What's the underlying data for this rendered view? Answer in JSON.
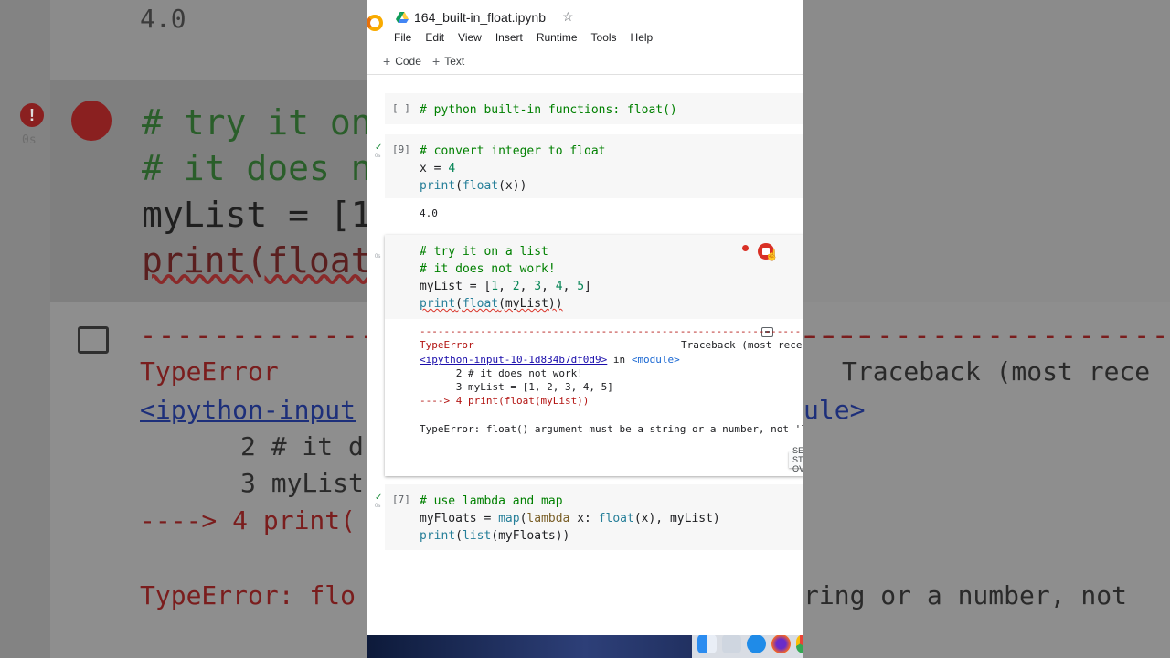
{
  "background_zoom": {
    "output_value": "4.0",
    "code_lines": [
      "# try it on",
      "# it does n",
      "myList = [1",
      "print(float"
    ],
    "dashes": "----------------------------------------",
    "error_type": "TypeError",
    "error_link_partial": "<ipython-input",
    "traceback_label": "Traceback (most rece",
    "module_partial": "ule>",
    "tb_line2": "2 # it d",
    "tb_line3": "3 myList",
    "tb_line4": "----> 4 print(",
    "error_msg_left": "TypeError: flo",
    "error_msg_right": "ring or a number, not",
    "status_label": "0s"
  },
  "notebook": {
    "title": "164_built-in_float.ipynb",
    "menu": [
      "File",
      "Edit",
      "View",
      "Insert",
      "Runtime",
      "Tools",
      "Help"
    ],
    "toolbar": {
      "code_label": "Code",
      "text_label": "Text"
    },
    "cells": [
      {
        "exec": "[ ]",
        "lines": [
          "# python built-in functions: float()"
        ]
      },
      {
        "exec": "[9]",
        "lines": [
          "# convert integer to float",
          "x = 4",
          "print(float(x))"
        ],
        "output": "4.0",
        "time": "0s"
      },
      {
        "exec": "",
        "lines": [
          "# try it on a list",
          "# it does not work!",
          "myList = [1, 2, 3, 4, 5]",
          "print(float(myList))"
        ],
        "time": "0s"
      },
      {
        "exec": "[7]",
        "lines": [
          "# use lambda and map",
          "myFloats = map(lambda x: float(x), myList)",
          "print(list(myFloats))"
        ],
        "time": "0s"
      }
    ],
    "error_output": {
      "dashes": "---------------------------------------------------------------------------",
      "error_type": "TypeError",
      "traceback_label": "Traceback (most recent call last)",
      "input_link": "<ipython-input-10-1d834b7df0d9>",
      "in_text": " in ",
      "module": "<module>",
      "tb_line2": "      2 # it does not work!",
      "tb_line3": "      3 myList = [1, 2, 3, 4, 5]",
      "tb_line4": "----> 4 print(float(myList))",
      "message": "TypeError: float() argument must be a string or a number, not 'list'",
      "search_button": "SEARCH STACK OVERFLOW"
    }
  },
  "dock": {
    "icons": [
      "finder-icon",
      "launchpad-icon",
      "safari-icon",
      "firefox-icon",
      "chrome-icon"
    ]
  },
  "colors": {
    "comment": "#008000",
    "error": "#b31412",
    "run_error": "#d93025",
    "link": "#1a0dab"
  }
}
